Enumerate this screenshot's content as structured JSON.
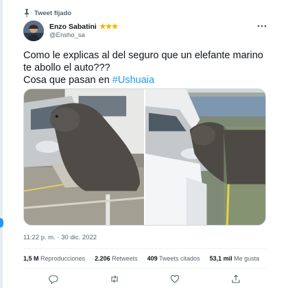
{
  "header": {
    "pinned_label": "Tweet fijado"
  },
  "author": {
    "name": "Enzo Sabatini",
    "badges": "★★★",
    "handle": "@Ensho_sa"
  },
  "tweet": {
    "text_line1": "Como le explicas al del seguro que un elefante marino",
    "text_line2": "te abollo el auto???",
    "text_line3_prefix": "Cosa que pasan en ",
    "hashtag": "#Ushuaia",
    "timestamp": "11:22 p. m. · 30 dic. 2022"
  },
  "stats": [
    {
      "value": "1,5 M",
      "label": "Reproducciones"
    },
    {
      "value": "2.206",
      "label": "Retweets"
    },
    {
      "value": "409",
      "label": "Tweets citados"
    },
    {
      "value": "53,1 mil",
      "label": "Me gusta"
    }
  ],
  "actions": {
    "reply": "reply-icon",
    "retweet": "retweet-icon",
    "like": "like-icon",
    "share": "share-icon"
  },
  "colors": {
    "accent": "#1d9bf0",
    "text": "#0f1419",
    "muted": "#536471",
    "star": "#f4b400"
  }
}
